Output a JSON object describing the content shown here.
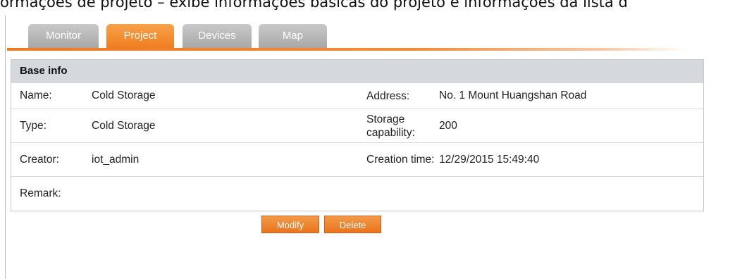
{
  "caption": "ormações de projeto – exibe informações básicas do projeto e informações da lista d",
  "tabs": [
    {
      "label": "Monitor",
      "active": false
    },
    {
      "label": "Project",
      "active": true
    },
    {
      "label": "Devices",
      "active": false
    },
    {
      "label": "Map",
      "active": false
    }
  ],
  "panel": {
    "title": "Base info",
    "rows": [
      {
        "label1": "Name:",
        "value1": "Cold Storage",
        "label2": "Address:",
        "value2": "No. 1 Mount Huangshan Road"
      },
      {
        "label1": "Type:",
        "value1": "Cold Storage",
        "label2": "Storage capability:",
        "value2": "200"
      },
      {
        "label1": "Creator:",
        "value1": "iot_admin",
        "label2": "Creation time:",
        "value2": "12/29/2015 15:49:40"
      },
      {
        "label1": "Remark:",
        "value1": "",
        "label2": "",
        "value2": ""
      }
    ]
  },
  "buttons": {
    "modify": "Modify",
    "delete": "Delete"
  },
  "colors": {
    "accent": "#ef7d1f",
    "inactive_tab": "#b5b5b5",
    "header_bg": "#d5d8dc"
  }
}
